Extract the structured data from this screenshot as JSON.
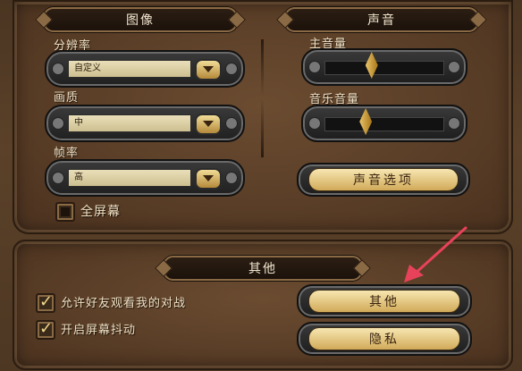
{
  "sections": {
    "image": "图像",
    "sound": "声音",
    "other": "其他"
  },
  "image": {
    "resolution_label": "分辨率",
    "resolution_value": "自定义",
    "quality_label": "画质",
    "quality_value": "中",
    "framerate_label": "帧率",
    "framerate_value": "高",
    "fullscreen_label": "全屏幕"
  },
  "sound": {
    "master_label": "主音量",
    "master_level": 0.4,
    "music_label": "音乐音量",
    "music_level": 0.35,
    "sound_options_button": "声音选项"
  },
  "other": {
    "allow_friends_label": "允许好友观看我的对战",
    "screen_shake_label": "开启屏幕抖动",
    "other_button": "其他",
    "privacy_button": "隐私"
  },
  "colors": {
    "annotation_arrow": "#e8425a"
  }
}
